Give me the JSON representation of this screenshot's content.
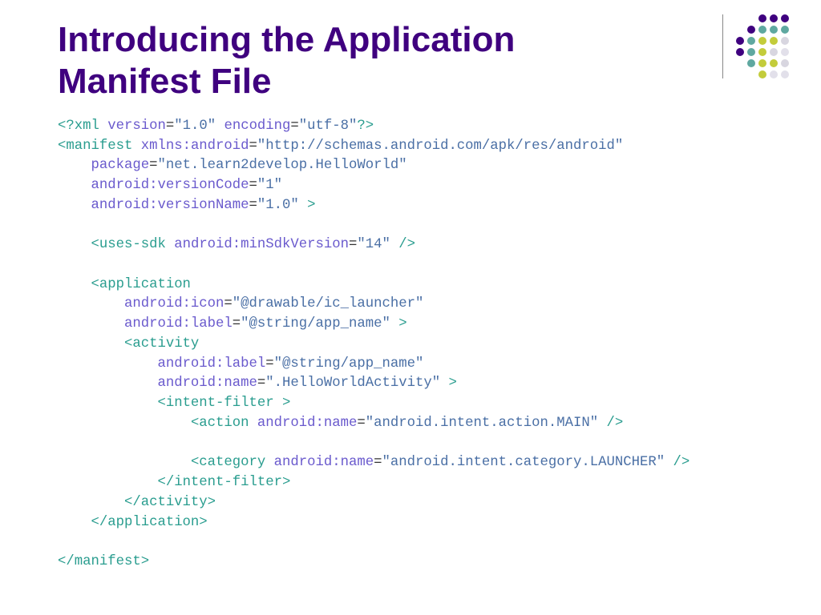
{
  "title": "Introducing the Application Manifest File",
  "code": {
    "xml_decl_version": "\"1.0\"",
    "xml_decl_encoding": "\"utf-8\"",
    "xmlns_value": "\"http://schemas.android.com/apk/res/android\"",
    "package_value": "\"net.learn2develop.HelloWorld\"",
    "versionCode_value": "\"1\"",
    "versionName_value": "\"1.0\"",
    "minSdk_value": "\"14\"",
    "app_icon_value": "\"@drawable/ic_launcher\"",
    "app_label_value": "\"@string/app_name\"",
    "activity_label_value": "\"@string/app_name\"",
    "activity_name_value": "\".HelloWorldActivity\"",
    "action_name_value": "\"android.intent.action.MAIN\"",
    "category_name_value": "\"android.intent.category.LAUNCHER\""
  }
}
